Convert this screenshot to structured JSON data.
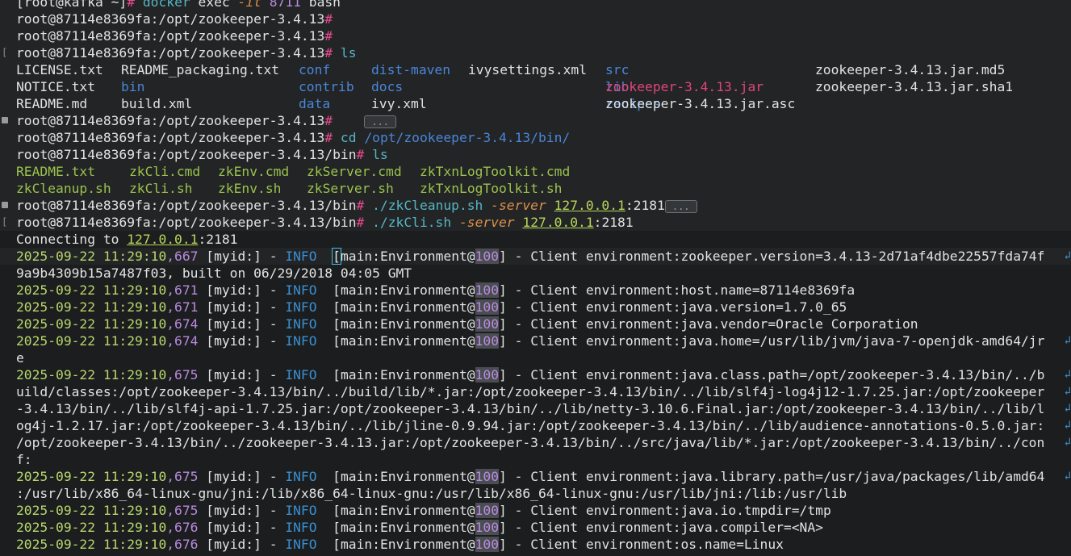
{
  "terminal": {
    "lines": [
      {
        "type": "cmd",
        "prompt": "[root@kafka ~]",
        "hash": "#",
        "command": "docker",
        "args": [
          " exec ",
          {
            "f": "-it"
          },
          " ",
          {
            "n": "8711"
          },
          " bash"
        ]
      },
      {
        "type": "cmd",
        "prompt": "root@87114e8369fa:/opt/zookeeper-3.4.13",
        "hash": "#"
      },
      {
        "type": "cmd",
        "prompt": "root@87114e8369fa:/opt/zookeeper-3.4.13",
        "hash": "#"
      },
      {
        "type": "cmd",
        "prompt": "root@87114e8369fa:/opt/zookeeper-3.4.13",
        "hash": "#",
        "command": "ls",
        "gutter": "bracket"
      }
    ],
    "ls_root": [
      [
        {
          "t": "LICENSE.txt",
          "c": "plain"
        },
        {
          "t": "README_packaging.txt",
          "c": "plain"
        },
        {
          "t": "conf",
          "c": "dir"
        },
        {
          "t": "dist-maven",
          "c": "dir"
        },
        {
          "t": "ivysettings.xml",
          "c": "plain"
        },
        {
          "t": "src",
          "c": "dir"
        },
        {
          "t": "",
          "c": "plain"
        },
        {
          "t": "zookeeper-3.4.13.jar.md5",
          "c": "plain"
        }
      ],
      [
        {
          "t": "NOTICE.txt",
          "c": "plain"
        },
        {
          "t": "bin",
          "c": "dir"
        },
        {
          "t": "contrib",
          "c": "dir"
        },
        {
          "t": "docs",
          "c": "dir"
        },
        {
          "t": "",
          "c": "plain"
        },
        {
          "t": "lib",
          "c": "dir"
        },
        {
          "t": "zookeeper-3.4.13.jar",
          "c": "jar"
        },
        {
          "t": "zookeeper-3.4.13.jar.sha1",
          "c": "plain"
        }
      ],
      [
        {
          "t": "README.md",
          "c": "plain"
        },
        {
          "t": "build.xml",
          "c": "plain"
        },
        {
          "t": "data",
          "c": "dir"
        },
        {
          "t": "ivy.xml",
          "c": "plain"
        },
        {
          "t": "",
          "c": "plain"
        },
        {
          "t": "recipes",
          "c": "dir"
        },
        {
          "t": "zookeeper-3.4.13.jar.asc",
          "c": "plain"
        },
        {
          "t": "",
          "c": "plain"
        }
      ]
    ],
    "prompt_root": "root@87114e8369fa:/opt/zookeeper-3.4.13",
    "prompt_bin": "root@87114e8369fa:/opt/zookeeper-3.4.13/bin",
    "fold_label": "...",
    "cd_cmd": "cd",
    "cd_arg": "/opt/zookeeper-3.4.13/bin/",
    "ls_cmd": "ls",
    "ls_bin": [
      [
        "README.txt",
        "zkCli.cmd",
        "zkEnv.cmd",
        "zkServer.cmd",
        "zkTxnLogToolkit.cmd"
      ],
      [
        "zkCleanup.sh",
        "zkCli.sh",
        "zkEnv.sh",
        "zkServer.sh",
        "zkTxnLogToolkit.sh"
      ]
    ],
    "cleanup_cmd": "./zkCleanup.sh",
    "zkcli_cmd": "./zkCli.sh",
    "server_flag": "-server",
    "server_ip": "127.0.0.1",
    "server_port": ":2181",
    "connecting": "Connecting to ",
    "log": [
      {
        "ts": "2025-09-22 11:29:10",
        "ms": ",667",
        "msg": "zookeeper.version=3.4.13-2d71af4dbe22557fda74f",
        "cont": [
          "9a9b4309b15a7487f03, built on 06/29/2018 04:05 GMT"
        ],
        "first": true
      },
      {
        "ts": "2025-09-22 11:29:10",
        "ms": ",671",
        "msg": "host.name=87114e8369fa"
      },
      {
        "ts": "2025-09-22 11:29:10",
        "ms": ",671",
        "msg": "java.version=1.7.0_65"
      },
      {
        "ts": "2025-09-22 11:29:10",
        "ms": ",674",
        "msg": "java.vendor=Oracle Corporation"
      },
      {
        "ts": "2025-09-22 11:29:10",
        "ms": ",674",
        "msg": "java.home=/usr/lib/jvm/java-7-openjdk-amd64/jr",
        "cont": [
          "e"
        ],
        "wrap": true
      },
      {
        "ts": "2025-09-22 11:29:10",
        "ms": ",675",
        "msg": "java.class.path=/opt/zookeeper-3.4.13/bin/../b",
        "cont": [
          "uild/classes:/opt/zookeeper-3.4.13/bin/../build/lib/*.jar:/opt/zookeeper-3.4.13/bin/../lib/slf4j-log4j12-1.7.25.jar:/opt/zookeeper",
          "-3.4.13/bin/../lib/slf4j-api-1.7.25.jar:/opt/zookeeper-3.4.13/bin/../lib/netty-3.10.6.Final.jar:/opt/zookeeper-3.4.13/bin/../lib/l",
          "og4j-1.2.17.jar:/opt/zookeeper-3.4.13/bin/../lib/jline-0.9.94.jar:/opt/zookeeper-3.4.13/bin/../lib/audience-annotations-0.5.0.jar:",
          "/opt/zookeeper-3.4.13/bin/../zookeeper-3.4.13.jar:/opt/zookeeper-3.4.13/bin/../src/java/lib/*.jar:/opt/zookeeper-3.4.13/bin/../con",
          "f:"
        ],
        "wrap": true
      },
      {
        "ts": "2025-09-22 11:29:10",
        "ms": ",675",
        "msg": "java.library.path=/usr/java/packages/lib/amd64",
        "cont": [
          ":/usr/lib/x86_64-linux-gnu/jni:/lib/x86_64-linux-gnu:/usr/lib/x86_64-linux-gnu:/usr/lib/jni:/lib:/usr/lib"
        ],
        "wrap": true
      },
      {
        "ts": "2025-09-22 11:29:10",
        "ms": ",675",
        "msg": "java.io.tmpdir=/tmp"
      },
      {
        "ts": "2025-09-22 11:29:10",
        "ms": ",676",
        "msg": "java.compiler=<NA>"
      },
      {
        "ts": "2025-09-22 11:29:10",
        "ms": ",676",
        "msg": "os.name=Linux"
      }
    ],
    "log_myid": "[myid:]",
    "log_dash": " - ",
    "log_level": "INFO",
    "log_thread": "main:Environment@",
    "log_line_no": "100",
    "log_client": " - Client environment:"
  }
}
